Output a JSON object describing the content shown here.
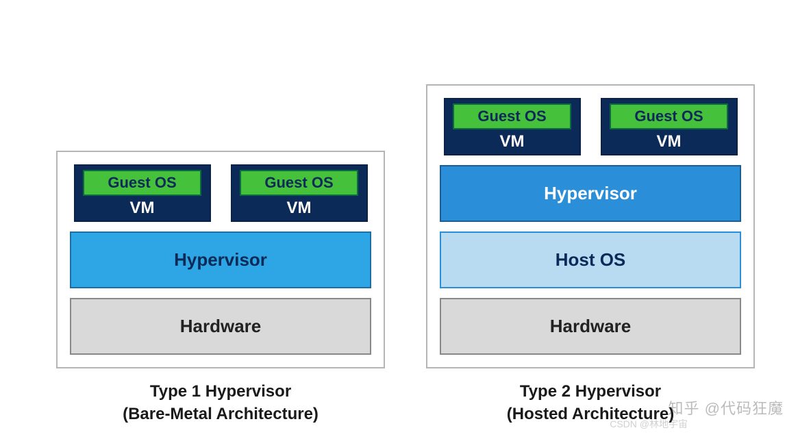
{
  "type1": {
    "title_line1": "Type 1 Hypervisor",
    "title_line2": "(Bare-Metal Architecture)",
    "vms": [
      {
        "guest_os": "Guest OS",
        "vm": "VM"
      },
      {
        "guest_os": "Guest OS",
        "vm": "VM"
      }
    ],
    "hypervisor": "Hypervisor",
    "hardware": "Hardware"
  },
  "type2": {
    "title_line1": "Type 2 Hypervisor",
    "title_line2": "(Hosted Architecture)",
    "vms": [
      {
        "guest_os": "Guest OS",
        "vm": "VM"
      },
      {
        "guest_os": "Guest OS",
        "vm": "VM"
      }
    ],
    "hypervisor": "Hypervisor",
    "host_os": "Host OS",
    "hardware": "Hardware"
  },
  "watermark_zhihu": "知乎 @代码狂魔",
  "watermark_csdn": "CSDN @林地宇宙"
}
